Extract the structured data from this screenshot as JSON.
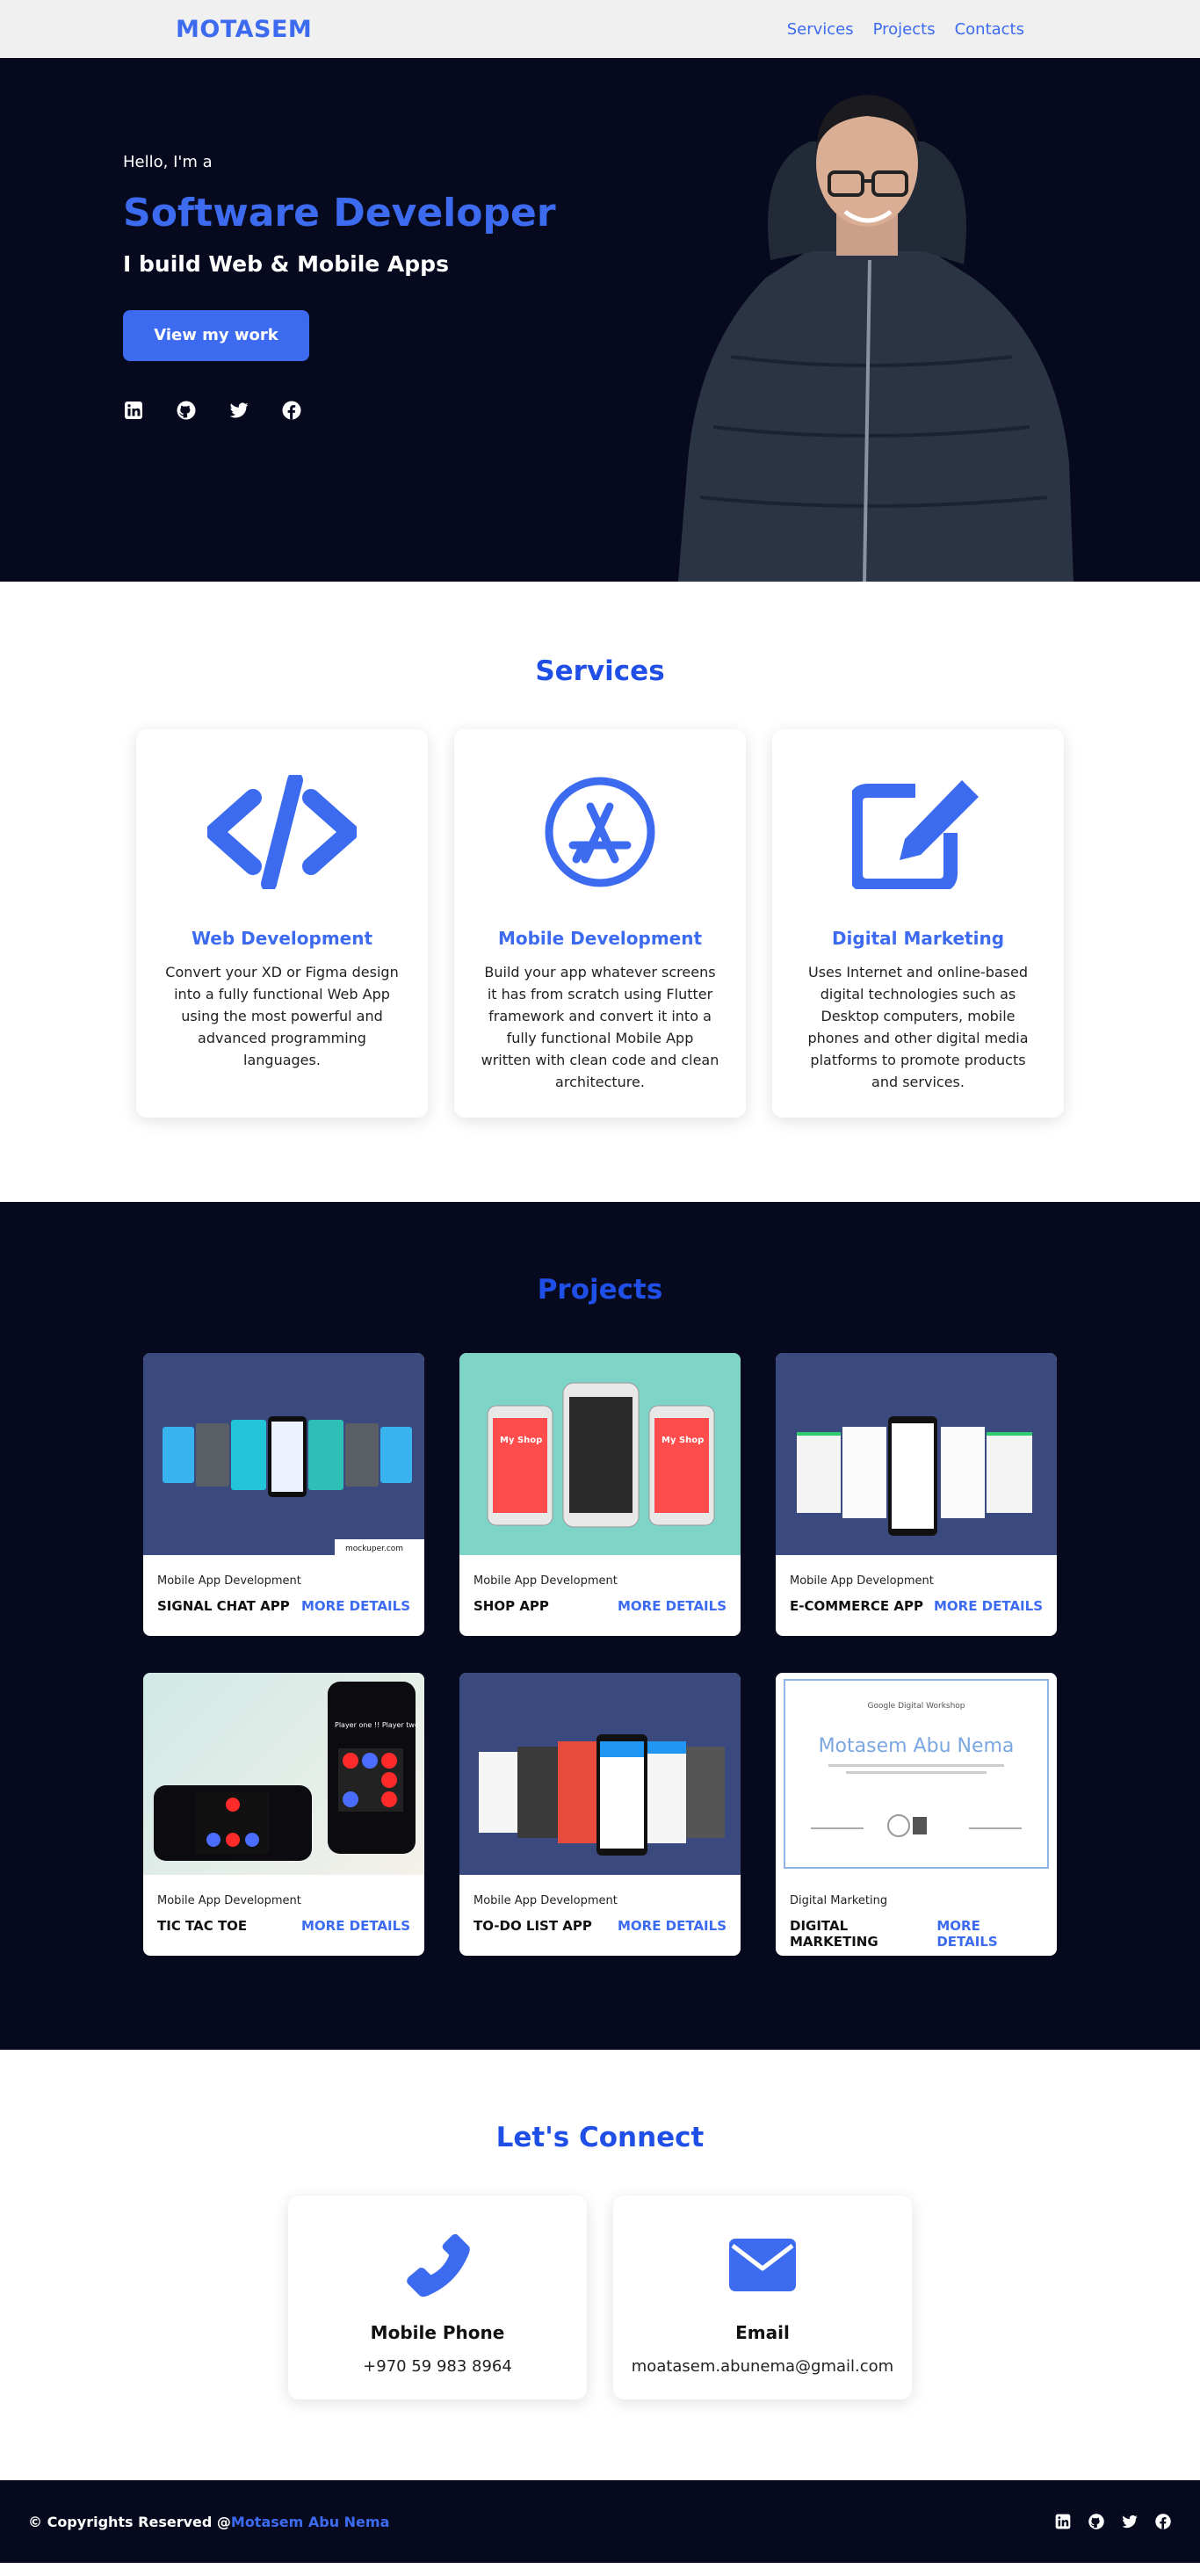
{
  "nav": {
    "logo": "MOTASEM",
    "links": [
      "Services",
      "Projects",
      "Contacts"
    ]
  },
  "hero": {
    "greeting": "Hello, I'm a",
    "title": "Software Developer",
    "subtitle": "I build Web & Mobile Apps",
    "cta": "View my work",
    "socials": [
      "linkedin-icon",
      "github-icon",
      "twitter-icon",
      "facebook-icon"
    ]
  },
  "services": {
    "title": "Services",
    "items": [
      {
        "name": "Web Development",
        "icon": "code-icon",
        "desc": "Convert your XD or Figma design into a fully functional Web App using the most powerful and advanced programming languages."
      },
      {
        "name": "Mobile Development",
        "icon": "app-store-icon",
        "desc": "Build your app whatever screens it has from scratch using Flutter framework and convert it into a fully functional Mobile App written with clean code and clean architecture."
      },
      {
        "name": "Digital Marketing",
        "icon": "edit-icon",
        "desc": "Uses Internet and online-based digital technologies such as Desktop computers, mobile phones and other digital media platforms to promote products and services."
      }
    ]
  },
  "projects": {
    "title": "Projects",
    "more_label": "MORE DETAILS",
    "items": [
      {
        "category": "Mobile App Development",
        "name": "SIGNAL CHAT APP",
        "watermark": "mockuper.com"
      },
      {
        "category": "Mobile App Development",
        "name": "SHOP APP",
        "screen_label": "My Shop"
      },
      {
        "category": "Mobile App Development",
        "name": "E-COMMERCE APP"
      },
      {
        "category": "Mobile App Development",
        "name": "TIC TAC TOE",
        "screen_label": "Player one !! Player two"
      },
      {
        "category": "Mobile App Development",
        "name": "TO-DO LIST APP"
      },
      {
        "category": "Digital Marketing",
        "name": "DIGITAL MARKETING",
        "certificate_org": "Google Digital Workshop",
        "certificate_name": "Motasem Abu Nema"
      }
    ]
  },
  "connect": {
    "title": "Let's Connect",
    "items": [
      {
        "title": "Mobile Phone",
        "value": "+970 59 983 8964",
        "icon": "phone-icon"
      },
      {
        "title": "Email",
        "value": "moatasem.abunema@gmail.com",
        "icon": "envelope-icon"
      }
    ]
  },
  "footer": {
    "prefix": "© Copyrights Reserved @",
    "name": "Motasem Abu Nema",
    "socials": [
      "linkedin-icon",
      "github-icon",
      "twitter-icon",
      "facebook-icon"
    ]
  },
  "colors": {
    "accent": "#3d6bf0",
    "dark": "#070a1e",
    "nav_bg": "#f0f0f0"
  }
}
